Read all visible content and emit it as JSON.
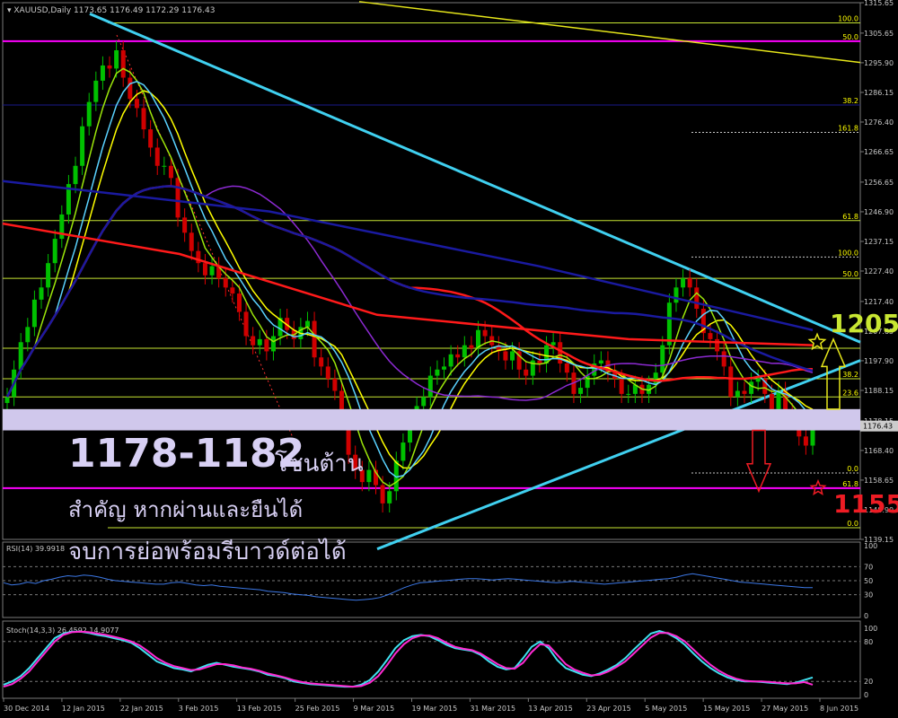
{
  "chart_data": [
    {
      "type": "candlestick",
      "symbol_label": "XAUUSD,Daily",
      "ohlc_header": "1173.65 1176.49 1172.29 1176.43",
      "price_ticks": [
        "1315.65",
        "1305.65",
        "1295.90",
        "1286.15",
        "1276.40",
        "1266.65",
        "1256.65",
        "1246.90",
        "1237.15",
        "1227.40",
        "1217.40",
        "1207.65",
        "1197.90",
        "1188.15",
        "1178.15",
        "1168.40",
        "1158.65",
        "1148.90",
        "1139.15"
      ],
      "current_price_label": "1176.43",
      "date_ticks": [
        "30 Dec 2014",
        "12 Jan 2015",
        "22 Jan 2015",
        "3 Feb 2015",
        "13 Feb 2015",
        "25 Feb 2015",
        "9 Mar 2015",
        "19 Mar 2015",
        "31 Mar 2015",
        "13 Apr 2015",
        "23 Apr 2015",
        "5 May 2015",
        "15 May 2015",
        "27 May 2015",
        "8 Jun 2015"
      ],
      "fib_labels_upper": [
        "100.0",
        "50.0",
        "38.2",
        "161.8",
        "61.8"
      ],
      "fib_labels_lower": [
        "100.0",
        "50.0",
        "38.2",
        "23.6",
        "0.0",
        "61.8",
        "0.0"
      ],
      "closes": [
        1186,
        1195,
        1204,
        1209,
        1218,
        1222,
        1230,
        1238,
        1246,
        1256,
        1262,
        1275,
        1283,
        1290,
        1295,
        1294,
        1300,
        1291,
        1284,
        1281,
        1274,
        1268,
        1262,
        1262,
        1258,
        1245,
        1240,
        1234,
        1230,
        1226,
        1229,
        1225,
        1222,
        1220,
        1214,
        1206,
        1203,
        1205,
        1201,
        1206,
        1212,
        1208,
        1205,
        1209,
        1211,
        1199,
        1196,
        1192,
        1188,
        1179,
        1167,
        1162,
        1158,
        1162,
        1157,
        1151,
        1155,
        1165,
        1171,
        1178,
        1183,
        1186,
        1193,
        1195,
        1196,
        1200,
        1199,
        1203,
        1202,
        1208,
        1206,
        1203,
        1201,
        1198,
        1201,
        1195,
        1193,
        1198,
        1197,
        1203,
        1204,
        1197,
        1194,
        1187,
        1189,
        1193,
        1197,
        1198,
        1194,
        1192,
        1187,
        1187,
        1190,
        1187,
        1190,
        1194,
        1203,
        1217,
        1222,
        1225,
        1222,
        1215,
        1207,
        1205,
        1201,
        1196,
        1186,
        1188,
        1187,
        1191,
        1192,
        1187,
        1182,
        1188,
        1181,
        1179,
        1173,
        1170,
        1176
      ],
      "highs_lows": {
        "period_high": 1307,
        "period_low": 1141
      },
      "indicators": {
        "moving_average_colors": [
          "#ffff00",
          "#9ce60a",
          "#5ad2ff",
          "#8c2ad2",
          "#ff1a1a",
          "#1a1aa0"
        ]
      },
      "annotations": {
        "zone_text_number": "1178-1182",
        "zone_text_thai": "โซนต้าน",
        "note_line2": "สำคัญ หากผ่านและยืนได้",
        "note_line3": "จบการย่อพร้อมรีบาวด์ต่อได้",
        "target_up": "1205",
        "target_down": "1155"
      }
    },
    {
      "type": "line",
      "name": "RSI(14) 39.9918",
      "ticks": [
        "100",
        "70",
        "50",
        "30",
        "0"
      ],
      "levels": [
        70,
        50,
        30
      ],
      "values": [
        47,
        44,
        45,
        48,
        46,
        50,
        52,
        55,
        57,
        56,
        58,
        57,
        55,
        52,
        50,
        49,
        48,
        47,
        46,
        45,
        45,
        47,
        48,
        46,
        44,
        43,
        44,
        42,
        41,
        40,
        39,
        38,
        37,
        35,
        34,
        33,
        31,
        30,
        29,
        27,
        26,
        25,
        24,
        23,
        22,
        23,
        24,
        26,
        30,
        35,
        40,
        44,
        47,
        48,
        49,
        50,
        51,
        52,
        53,
        53,
        52,
        51,
        52,
        53,
        52,
        51,
        50,
        49,
        48,
        47,
        48,
        49,
        48,
        47,
        46,
        45,
        46,
        47,
        48,
        49,
        50,
        51,
        52,
        53,
        55,
        58,
        60,
        58,
        56,
        54,
        52,
        50,
        48,
        47,
        46,
        45,
        44,
        43,
        42,
        41,
        40,
        40
      ]
    },
    {
      "type": "line",
      "name": "Stoch(14,3,3) 26.4592 14.9077",
      "ticks": [
        "100",
        "80",
        "20",
        "0"
      ],
      "levels": [
        80,
        20
      ],
      "series": [
        {
          "values": [
            15,
            20,
            28,
            40,
            55,
            70,
            85,
            92,
            95,
            95,
            93,
            90,
            88,
            85,
            82,
            78,
            70,
            60,
            50,
            45,
            40,
            38,
            35,
            40,
            45,
            48,
            45,
            42,
            40,
            38,
            35,
            30,
            28,
            25,
            20,
            18,
            16,
            15,
            14,
            13,
            12,
            12,
            15,
            22,
            35,
            52,
            70,
            82,
            88,
            90,
            88,
            82,
            75,
            70,
            68,
            66,
            60,
            50,
            42,
            38,
            40,
            55,
            72,
            80,
            70,
            52,
            40,
            35,
            30,
            28,
            32,
            38,
            45,
            55,
            68,
            80,
            92,
            96,
            92,
            85,
            75,
            62,
            50,
            40,
            32,
            26,
            22,
            20,
            20,
            19,
            18,
            17,
            16,
            18,
            22,
            26
          ]
        },
        {
          "values": [
            12,
            16,
            24,
            35,
            50,
            65,
            80,
            90,
            94,
            95,
            94,
            92,
            90,
            87,
            84,
            80,
            74,
            65,
            55,
            48,
            43,
            40,
            37,
            38,
            42,
            46,
            46,
            44,
            41,
            39,
            36,
            32,
            29,
            26,
            22,
            19,
            17,
            16,
            15,
            14,
            13,
            12,
            13,
            18,
            28,
            44,
            62,
            76,
            85,
            89,
            89,
            85,
            78,
            72,
            69,
            67,
            62,
            54,
            46,
            40,
            39,
            48,
            64,
            76,
            74,
            60,
            46,
            38,
            33,
            29,
            30,
            35,
            42,
            50,
            62,
            74,
            86,
            93,
            93,
            88,
            80,
            68,
            56,
            45,
            36,
            29,
            24,
            21,
            20,
            20,
            19,
            18,
            17,
            17,
            19,
            15
          ]
        }
      ]
    }
  ]
}
